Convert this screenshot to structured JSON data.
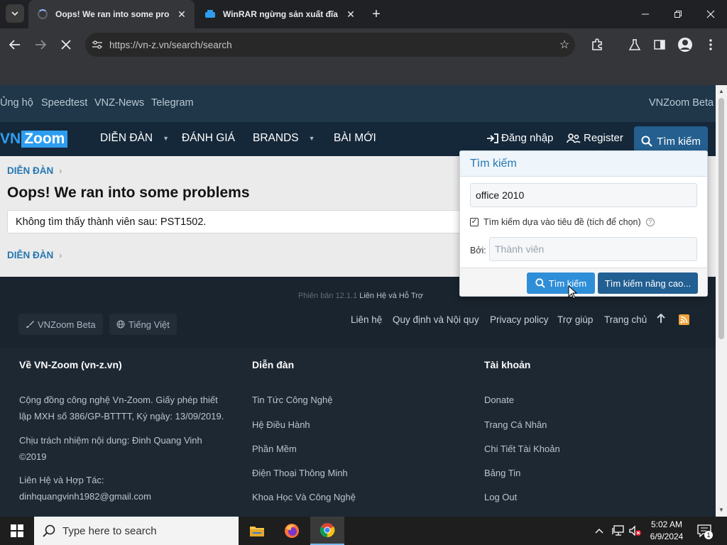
{
  "browser": {
    "tabs": [
      {
        "title": "Oops! We ran into some probl",
        "active": true,
        "loading": true
      },
      {
        "title": "WinRAR ngừng sản xuất đĩa và",
        "active": false,
        "favicon": "vn-zoom-icon"
      }
    ],
    "url": "https://vn-z.vn/search/search"
  },
  "site": {
    "topbar_links": [
      "Ủng hộ",
      "Speedtest",
      "VNZ-News",
      "Telegram"
    ],
    "topbar_right": "VNZoom Beta",
    "logo": {
      "part1": "VN",
      "part2": "Zoom"
    },
    "nav": [
      "DIỄN ĐÀN",
      "ĐÁNH GIÁ",
      "BRANDS",
      "BÀI MỚI"
    ],
    "login": "Đăng nhập",
    "register": "Register",
    "search_tab": "Tìm kiếm",
    "colors": {
      "topbar": "#1f3748",
      "navbar": "#15283a",
      "accent": "#2e9df0",
      "link": "#2577b1"
    }
  },
  "content": {
    "breadcrumb": "DIỄN ĐÀN",
    "title": "Oops! We ran into some problems",
    "error": "Không tìm thấy thành viên sau: PST1502.",
    "breadcrumb_bottom": "DIỄN ĐÀN"
  },
  "search_popup": {
    "title": "Tìm kiếm",
    "query": "office 2010",
    "title_only_label": "Tìm kiếm dựa vào tiêu đề (tích để chọn)",
    "title_only_checked": true,
    "by_label": "Bởi:",
    "member_placeholder": "Thành viên",
    "submit": "Tìm kiếm",
    "advanced": "Tìm kiếm nâng cao..."
  },
  "footer": {
    "version_prefix": "Phiên bản 12.1.1",
    "version_link": "Liên Hệ và Hỗ Trợ",
    "style_chooser": "VNZoom Beta",
    "language": "Tiếng Việt",
    "links": [
      "Liên hệ",
      "Quy định và Nội quy",
      "Privacy policy",
      "Trợ giúp",
      "Trang chủ"
    ],
    "col1": {
      "title": "Về VN-Zoom (vn-z.vn)",
      "p1a": "Cộng đồng công nghệ Vn-Zoom. Giấy phép thiết",
      "p1b": "lập MXH số 386/GP-BTTTT, Ký ngày: 13/09/2019.",
      "p2a": "Chịu trách nhiệm nội dung: Đinh Quang Vinh",
      "p2b": "©2019",
      "p3a": "Liên Hệ và Hợp Tác:",
      "p3b": "dinhquangvinh1982@gmail.com"
    },
    "col2": {
      "title": "Diễn đàn",
      "items": [
        "Tin Tức Công Nghệ",
        "Hệ Điều Hành",
        "Phần Mềm",
        "Điện Thoại Thông Minh",
        "Khoa Học Và Công Nghệ"
      ]
    },
    "col3": {
      "title": "Tài khoản",
      "items": [
        "Donate",
        "Trang Cá Nhân",
        "Chi Tiết Tài Khoản",
        "Bảng Tin",
        "Log Out"
      ]
    }
  },
  "taskbar": {
    "search_placeholder": "Type here to search",
    "time": "5:02 AM",
    "date": "6/9/2024",
    "notification_count": "1"
  }
}
